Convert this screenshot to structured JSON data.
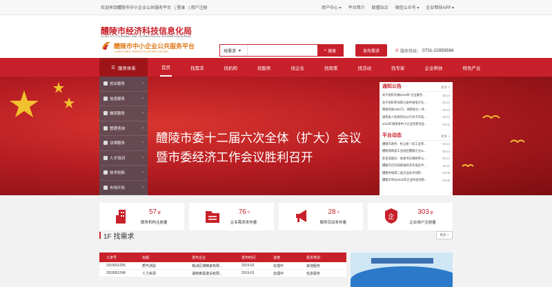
{
  "topbar": {
    "welcome": "欢迎来到醴陵市中小企业公共服务平台",
    "login": "登录",
    "register": "用户注册",
    "links": [
      "用户中心 ▾",
      "平台简介",
      "联盟站点",
      "微信公众号 ▾",
      "企业帮扶APP ▾"
    ]
  },
  "logo": {
    "main": "醴陵市经济科技信息化局",
    "en1": "LILING CITY ECONOMIC AND TECHNOLOGICAL INFORMATION BUREAU",
    "sub": "醴陵市中小企业公共服务平台",
    "en2": "LILING PUBLIC SERVICE PLATFORM FOR SME"
  },
  "search": {
    "select": "找需求",
    "placeholder": "",
    "button": "搜索"
  },
  "post_button": "发布需求",
  "hotline": {
    "label": "服务热线：",
    "number": "0731-22959566"
  },
  "nav": {
    "category": "服务体系",
    "items": [
      "首页",
      "找需求",
      "找机构",
      "找服务",
      "找企业",
      "找政策",
      "找活动",
      "找专家",
      "企业帮扶",
      "特色产业"
    ]
  },
  "side_menu": [
    "创业服务",
    "信息服务",
    "融资服务",
    "管理咨询",
    "法律服务",
    "人才培训",
    "技术创新",
    "市场开拓"
  ],
  "hero": {
    "line1": "醴陵市委十二届六次全体（扩大）会议",
    "line2": "暨市委经济工作会议胜利召开"
  },
  "notice": {
    "title": "通知公告",
    "more": "更多 >",
    "items": [
      {
        "text": "关于组织开展2019年“企业服务...",
        "date": "03.14"
      },
      {
        "text": "关于组织参加第七届中国电子信...",
        "date": "03.14"
      },
      {
        "text": "需规奖励3000万，湖南省企一步...",
        "date": "03.13"
      },
      {
        "text": "湖南省人民政府办公厅关于印发...",
        "date": "03.12"
      },
      {
        "text": "2019年湖南省中小企业创新创业...",
        "date": "03.01"
      }
    ]
  },
  "dynamics": {
    "title": "平台动态",
    "more": "更多 >",
    "items": [
      {
        "text": "醴陵市政务：抢占新一轮工业革...",
        "date": "03.14"
      },
      {
        "text": "醴陵湖南省工业园区醴陵企业公...",
        "date": "03.14"
      },
      {
        "text": "彭佰成副长：省委书记调研参与...",
        "date": "03.14"
      },
      {
        "text": "醴陵市召开国家级经济开发区申...",
        "date": "03.11"
      },
      {
        "text": "醴陵中国第二届企业技术创新...",
        "date": "03.09"
      },
      {
        "text": "醴陵市举办2019年企业科技创新...",
        "date": "03.08"
      }
    ]
  },
  "stats": [
    {
      "value": "57",
      "unit": "家",
      "label": "服务机构注册量",
      "icon": "building-icon"
    },
    {
      "value": "76",
      "unit": "个",
      "label": "企业需求发布量",
      "icon": "folder-icon"
    },
    {
      "value": "28",
      "unit": "个",
      "label": "服务活动发布量",
      "icon": "megaphone-icon"
    },
    {
      "value": "303",
      "unit": "家",
      "label": "企业用户注册量",
      "icon": "shield-enterprise-icon"
    }
  ],
  "section1": {
    "title": "1F 找需求",
    "more": "更多 +",
    "headers": [
      "工单号",
      "标题",
      "发布企业",
      "发布时间",
      "进度",
      "需求类别"
    ],
    "rows": [
      [
        "2019031255",
        "质气测验",
        "株洲区博精瓷有限...",
        "2019-03",
        "处理中",
        "其他服务"
      ],
      [
        "2019051248",
        "人力资源",
        "湖南泰嘉建设有限...",
        "2019-03",
        "处理中",
        "信息服务"
      ]
    ]
  }
}
